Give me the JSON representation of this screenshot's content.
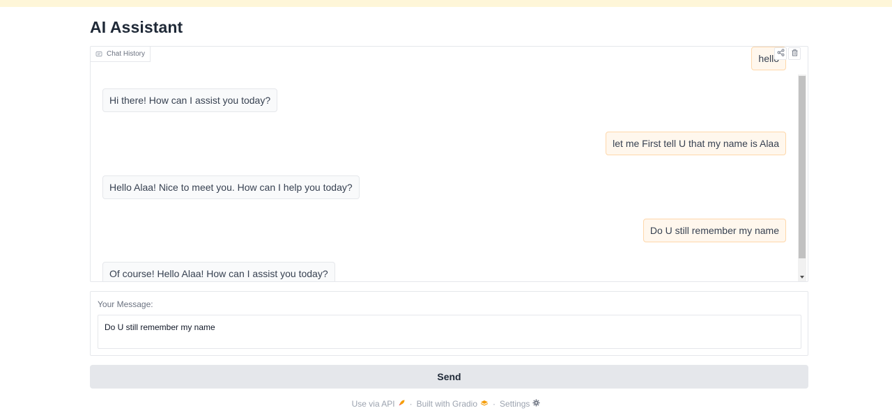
{
  "app": {
    "title": "AI Assistant"
  },
  "chat": {
    "label": "Chat History",
    "messages": [
      {
        "role": "user",
        "text": "hello"
      },
      {
        "role": "bot",
        "text": "Hi there! How can I assist you today?"
      },
      {
        "role": "user",
        "text": "let me First tell U that my name is Alaa"
      },
      {
        "role": "bot",
        "text": "Hello Alaa! Nice to meet you. How can I help you today?"
      },
      {
        "role": "user",
        "text": "Do U still remember my name"
      },
      {
        "role": "bot",
        "text": "Of course! Hello Alaa! How can I assist you today?"
      }
    ],
    "actions": [
      {
        "icon": "share-icon"
      },
      {
        "icon": "trash-icon"
      }
    ]
  },
  "input": {
    "label": "Your Message:",
    "value": "Do U still remember my name"
  },
  "send": {
    "label": "Send"
  },
  "footer": {
    "api": "Use via API",
    "built": "Built with Gradio",
    "settings": "Settings",
    "sep": "·"
  },
  "colors": {
    "top_strip": "#fef6d8",
    "user_bubble": "#fff7ed",
    "user_border": "#fed7aa",
    "bot_bubble": "#f9fafb",
    "send_bg": "#e5e7eb",
    "accent": "#f59e0b"
  }
}
